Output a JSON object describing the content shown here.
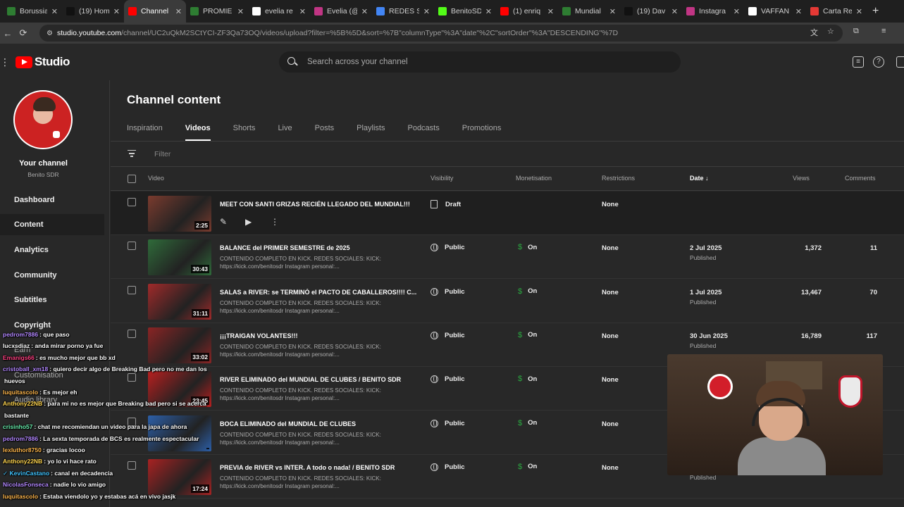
{
  "browser": {
    "tabs": [
      {
        "label": "Borussia",
        "color": "#2e7d32"
      },
      {
        "label": "(19) Hom",
        "color": "#111111"
      },
      {
        "label": "Channel",
        "color": "#ff0000",
        "active": true
      },
      {
        "label": "PROMIE",
        "color": "#2e7d32"
      },
      {
        "label": "evelia re",
        "color": "#ffffff"
      },
      {
        "label": "Evelia (@",
        "color": "#c13584"
      },
      {
        "label": "REDES S",
        "color": "#4285f4"
      },
      {
        "label": "BenitoSD",
        "color": "#53fc18"
      },
      {
        "label": "(1) enriq",
        "color": "#ff0000"
      },
      {
        "label": "Mundial",
        "color": "#2e7d32"
      },
      {
        "label": "(19) Dav",
        "color": "#111111"
      },
      {
        "label": "Instagra",
        "color": "#c13584"
      },
      {
        "label": "VAFFAN",
        "color": "#ffffff"
      },
      {
        "label": "Carta Re",
        "color": "#e53935"
      }
    ],
    "url_site": "studio.youtube.com",
    "url_path": "/channel/UC2uQkM2SCtYCI-ZF3Qa73OQ/videos/upload?filter=%5B%5D&sort=%7B\"columnType\"%3A\"date\"%2C\"sortOrder\"%3A\"DESCENDING\"%7D"
  },
  "header": {
    "logo_text": "Studio",
    "search_placeholder": "Search across your channel"
  },
  "sidebar": {
    "channel_title": "Your channel",
    "channel_name": "Benito SDR",
    "items": [
      "Dashboard",
      "Content",
      "Analytics",
      "Community",
      "Subtitles",
      "Copyright",
      "Earn",
      "Customisation",
      "Audio library"
    ],
    "active": "Content"
  },
  "main": {
    "title": "Channel content",
    "tabs": [
      "Inspiration",
      "Videos",
      "Shorts",
      "Live",
      "Posts",
      "Playlists",
      "Podcasts",
      "Promotions"
    ],
    "active_tab": "Videos",
    "filter_placeholder": "Filter",
    "columns": {
      "video": "Video",
      "visibility": "Visibility",
      "monetisation": "Monetisation",
      "restrictions": "Restrictions",
      "date": "Date",
      "views": "Views",
      "comments": "Comments"
    },
    "rows": [
      {
        "title": "MEET CON SANTI GRIZAS RECIÉN LLEGADO DEL MUNDIAL!!!",
        "desc": "",
        "duration": "2:25",
        "visibility": "Draft",
        "monetisation": "",
        "restrictions": "None",
        "date": "",
        "status": "",
        "views": "",
        "comments": ""
      },
      {
        "title": "BALANCE del PRIMER SEMESTRE de 2025",
        "desc": "CONTENIDO COMPLETO EN KICK. REDES SOCIALES: KICK: https://kick.com/benitosdr Instagram personal:...",
        "duration": "30:43",
        "visibility": "Public",
        "monetisation": "On",
        "restrictions": "None",
        "date": "2 Jul 2025",
        "status": "Published",
        "views": "1,372",
        "comments": "11"
      },
      {
        "title": "SALAS a RIVER: se TERMINÓ el PACTO DE CABALLEROS!!!! C...",
        "desc": "CONTENIDO COMPLETO EN KICK. REDES SOCIALES: KICK: https://kick.com/benitosdr Instagram personal:...",
        "duration": "31:11",
        "visibility": "Public",
        "monetisation": "On",
        "restrictions": "None",
        "date": "1 Jul 2025",
        "status": "Published",
        "views": "13,467",
        "comments": "70"
      },
      {
        "title": "¡¡¡TRAIGAN VOLANTES!!!",
        "desc": "CONTENIDO COMPLETO EN KICK. REDES SOCIALES: KICK: https://kick.com/benitosdr Instagram personal:...",
        "duration": "33:02",
        "visibility": "Public",
        "monetisation": "On",
        "restrictions": "None",
        "date": "30 Jun 2025",
        "status": "Published",
        "views": "16,789",
        "comments": "117"
      },
      {
        "title": "RIVER ELIMINADO del MUNDIAL DE CLUBES / BENITO SDR",
        "desc": "CONTENIDO COMPLETO EN KICK. REDES SOCIALES: KICK: https://kick.com/benitosdr Instagram personal:...",
        "duration": "23:45",
        "visibility": "Public",
        "monetisation": "On",
        "restrictions": "None",
        "date": "",
        "status": "",
        "views": "",
        "comments": ""
      },
      {
        "title": "BOCA ELIMINADO del MUNDIAL DE CLUBES",
        "desc": "CONTENIDO COMPLETO EN KICK. REDES SOCIALES: KICK: https://kick.com/benitosdr Instagram personal:...",
        "duration": "",
        "visibility": "Public",
        "monetisation": "On",
        "restrictions": "None",
        "date": "",
        "status": "",
        "views": "",
        "comments": ""
      },
      {
        "title": "PREVIA de RIVER vs INTER. A todo o nada! / BENITO SDR",
        "desc": "CONTENIDO COMPLETO EN KICK. REDES SOCIALES: KICK: https://kick.com/benitosdr Instagram personal:...",
        "duration": "17:24",
        "visibility": "Public",
        "monetisation": "On",
        "restrictions": "None",
        "date": "",
        "status": "Published",
        "views": "",
        "comments": ""
      }
    ]
  },
  "chat": [
    {
      "user": "pedrom7886",
      "color": "#b388ff",
      "msg": ": que paso"
    },
    {
      "user": "lucxsdiaz",
      "color": "#ffffff",
      "msg": ": anda mirar porno ya fue"
    },
    {
      "user": "Emanigs66",
      "color": "#ff4081",
      "msg": ": es mucho mejor que bb xd"
    },
    {
      "user": "cristoball_xm18",
      "color": "#b388ff",
      "msg": ": quiero decir algo de Breaking Bad pero no me dan los"
    },
    {
      "user": "",
      "color": "#ffffff",
      "msg": "huevos"
    },
    {
      "user": "luquitascolo",
      "color": "#ffb74d",
      "msg": ": Es mejor eh"
    },
    {
      "user": "Anthony22NB",
      "color": "#ffd54f",
      "msg": ": para mi no es mejor que Breaking bad pero si se acerca"
    },
    {
      "user": "",
      "color": "#ffffff",
      "msg": "bastante"
    },
    {
      "user": "crisinho57",
      "color": "#69f0ae",
      "msg": ": chat me recomiendan un video para la japa de ahora"
    },
    {
      "user": "pedrom7886",
      "color": "#b388ff",
      "msg": ": La sexta temporada de BCS es realmente espectacular"
    },
    {
      "user": "lexluthor8750",
      "color": "#ffb74d",
      "msg": ": gracias locoo"
    },
    {
      "user": "Anthony22NB",
      "color": "#ffd54f",
      "msg": ": yo lo vi hace rato"
    },
    {
      "user": "✓ KevinCastano",
      "color": "#40c4ff",
      "msg": ": canal en decadencia"
    },
    {
      "user": "NicolasFonseca",
      "color": "#b388ff",
      "msg": ": nadie lo vio amigo"
    },
    {
      "user": "luquitascolo",
      "color": "#ffb74d",
      "msg": ": Estaba viendolo yo y estabas acá en vivo jasjk"
    }
  ]
}
